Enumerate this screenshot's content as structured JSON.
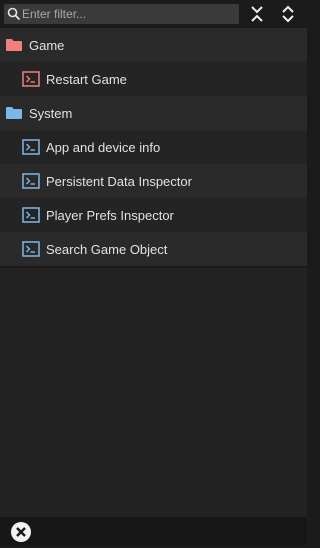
{
  "search": {
    "placeholder": "Enter filter...",
    "value": ""
  },
  "toolbar": {
    "expand_all_icon": "expand-all-icon",
    "collapse_all_icon": "collapse-all-icon"
  },
  "colors": {
    "game_category": "#f07f7f",
    "system_category": "#7fb6e8",
    "background": "#1b1b1b"
  },
  "tree": {
    "categories": [
      {
        "label": "Game",
        "icon": "folder-icon",
        "color": "#f07f7f",
        "commands": [
          {
            "label": "Restart Game",
            "icon": "terminal-icon"
          }
        ]
      },
      {
        "label": "System",
        "icon": "folder-icon",
        "color": "#7fb6e8",
        "commands": [
          {
            "label": "App and device info",
            "icon": "terminal-icon"
          },
          {
            "label": "Persistent Data Inspector",
            "icon": "terminal-icon"
          },
          {
            "label": "Player Prefs Inspector",
            "icon": "terminal-icon"
          },
          {
            "label": "Search Game Object",
            "icon": "terminal-icon"
          }
        ]
      }
    ]
  },
  "footer": {
    "close_icon": "close-icon"
  }
}
